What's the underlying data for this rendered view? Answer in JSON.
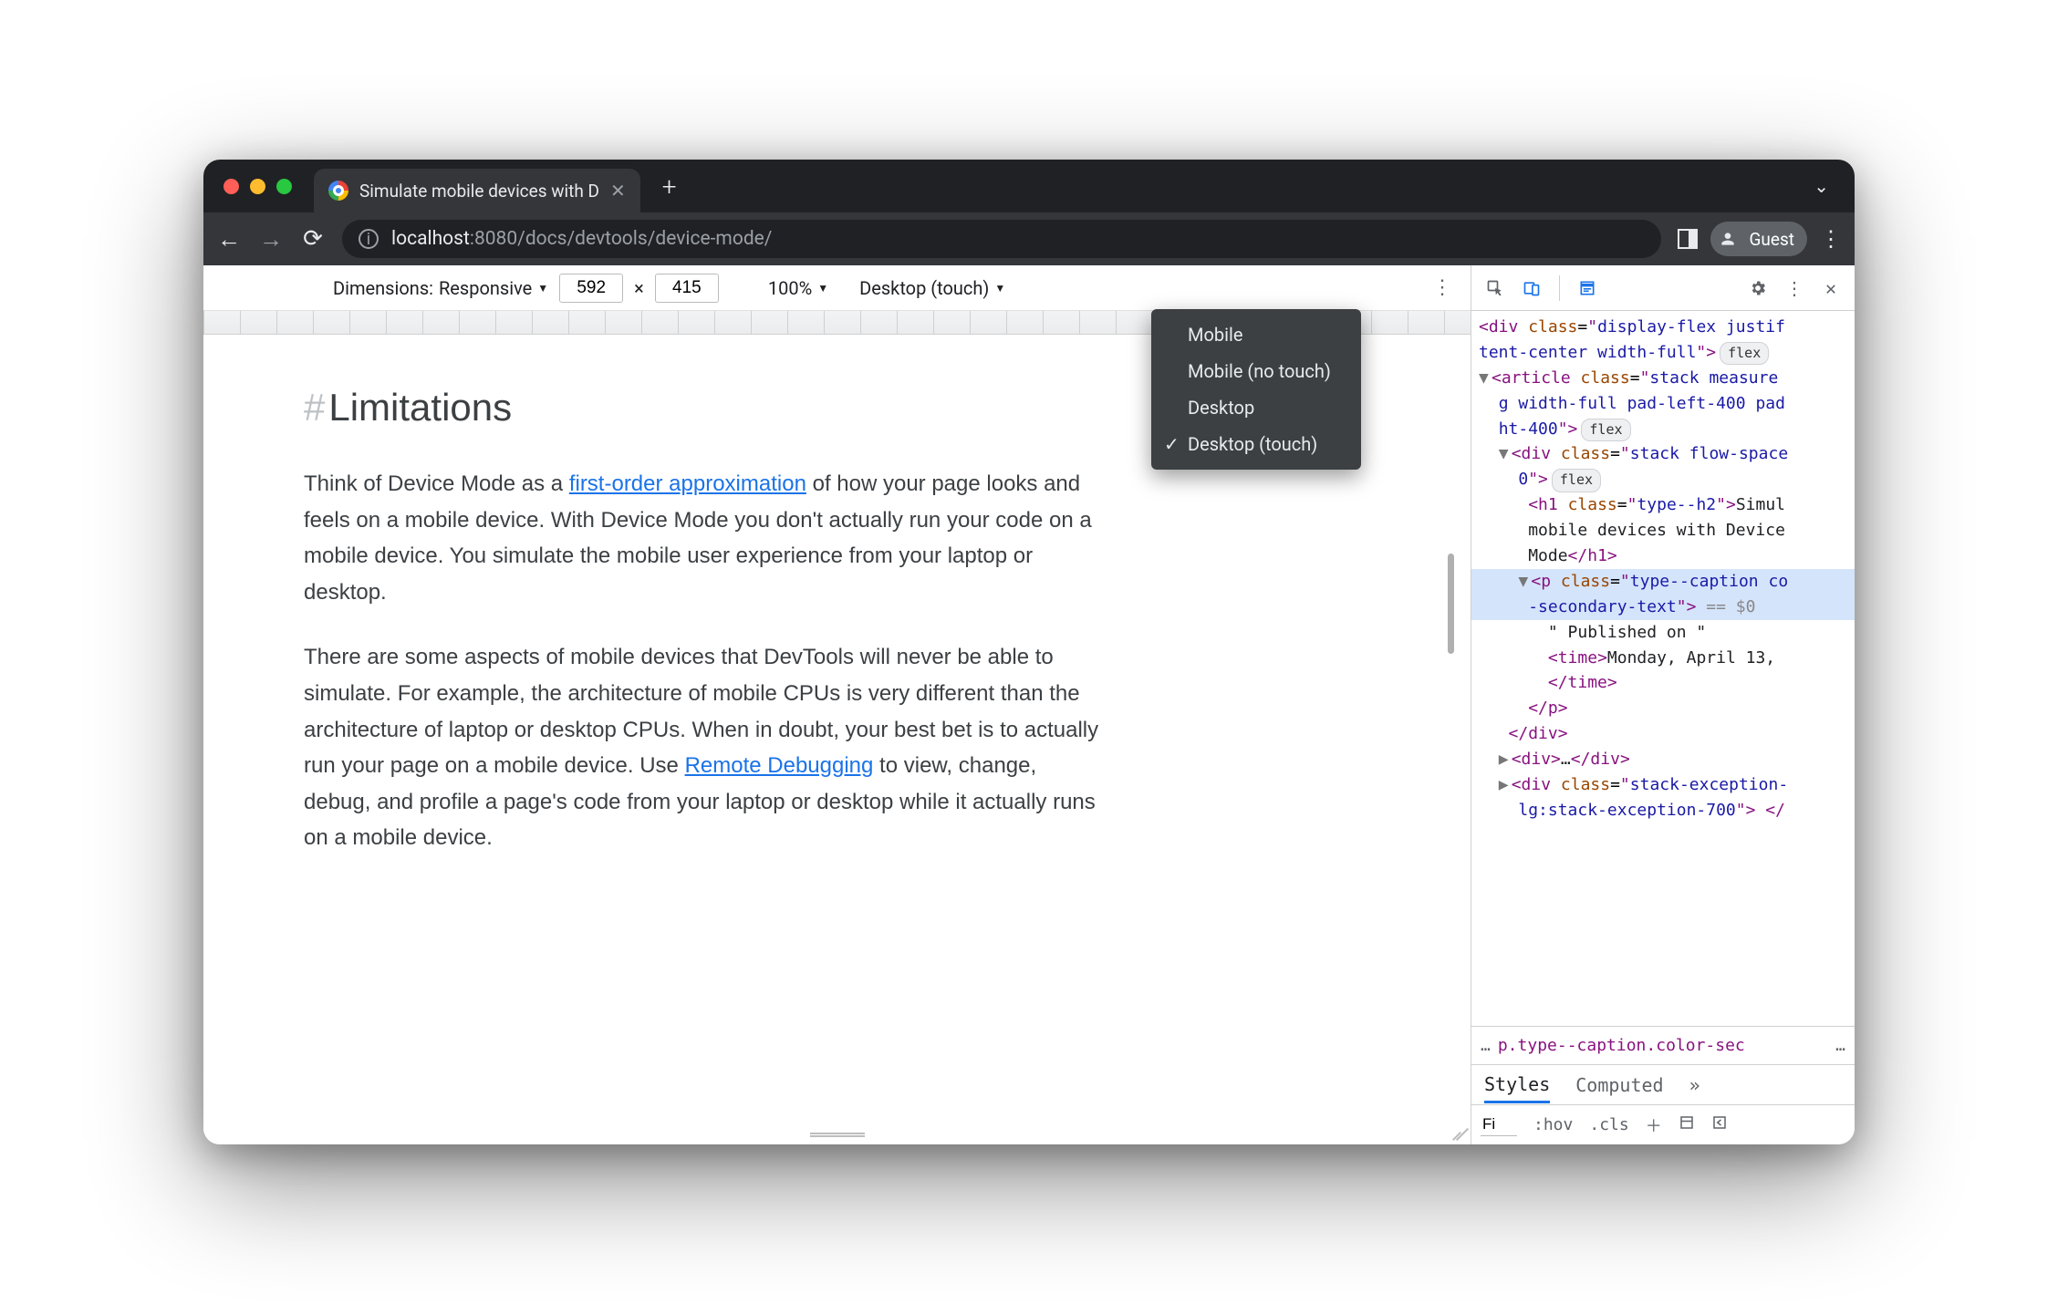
{
  "tab": {
    "title": "Simulate mobile devices with D"
  },
  "toolbar": {
    "url_host": "localhost",
    "url_port": ":8080",
    "url_path": "/docs/devtools/device-mode/",
    "guest": "Guest"
  },
  "device_toolbar": {
    "dimensions_label": "Dimensions:",
    "dimensions_mode": "Responsive",
    "width": "592",
    "height": "415",
    "times": "×",
    "zoom": "100%",
    "throttle": "Desktop (touch)"
  },
  "dropdown": {
    "items": [
      "Mobile",
      "Mobile (no touch)",
      "Desktop",
      "Desktop (touch)"
    ],
    "selected": "Desktop (touch)"
  },
  "page": {
    "heading": "Limitations",
    "p1_a": "Think of Device Mode as a ",
    "p1_link": "first-order approximation",
    "p1_b": " of how your page looks and feels on a mobile device. With Device Mode you don't actually run your code on a mobile device. You simulate the mobile user experience from your laptop or desktop.",
    "p2_a": "There are some aspects of mobile devices that DevTools will never be able to simulate. For example, the architecture of mobile CPUs is very different than the architecture of laptop or desktop CPUs. When in doubt, your best bet is to actually run your page on a mobile device. Use ",
    "p2_link": "Remote Debugging",
    "p2_b": " to view, change, debug, and profile a page's code from your laptop or desktop while it actually runs on a mobile device."
  },
  "dom": {
    "l1_a": "div",
    "l1_b": "class",
    "l1_c": "display-flex justif",
    "l2": "tent-center width-full",
    "l2_pill": "flex",
    "l3_a": "article",
    "l3_b": "class",
    "l3_c": "stack measure",
    "l4": "g width-full pad-left-400 pad",
    "l5": "ht-400",
    "l5_pill": "flex",
    "l6_a": "div",
    "l6_b": "class",
    "l6_c": "stack flow-space",
    "l7": "0",
    "l7_pill": "flex",
    "l8_a": "h1",
    "l8_b": "class",
    "l8_c": "type--h2",
    "l8_t": "Simul",
    "l9": "mobile devices with Device",
    "l10_a": "Mode",
    "l10_b": "h1",
    "l11_a": "p",
    "l11_b": "class",
    "l11_c": "type--caption co",
    "l12": "-secondary-text",
    "l12_sel": " == $0",
    "l13": "\" Published on \"",
    "l14_a": "time",
    "l14_t": "Monday, April 13,",
    "l15": "time",
    "l16": "p",
    "l17": "div",
    "l18_a": "div",
    "l18_d": "…",
    "l18_b": "div",
    "l19_a": "div",
    "l19_b": "class",
    "l19_c": "stack-exception-",
    "l20": "lg:stack-exception-700"
  },
  "crumbs": {
    "dots": "…",
    "text": "p.type--caption.color-sec",
    "more": "…"
  },
  "styles": {
    "tab1": "Styles",
    "tab2": "Computed",
    "more": "»",
    "filter": "Fi",
    "hov": ":hov",
    "cls": ".cls"
  }
}
